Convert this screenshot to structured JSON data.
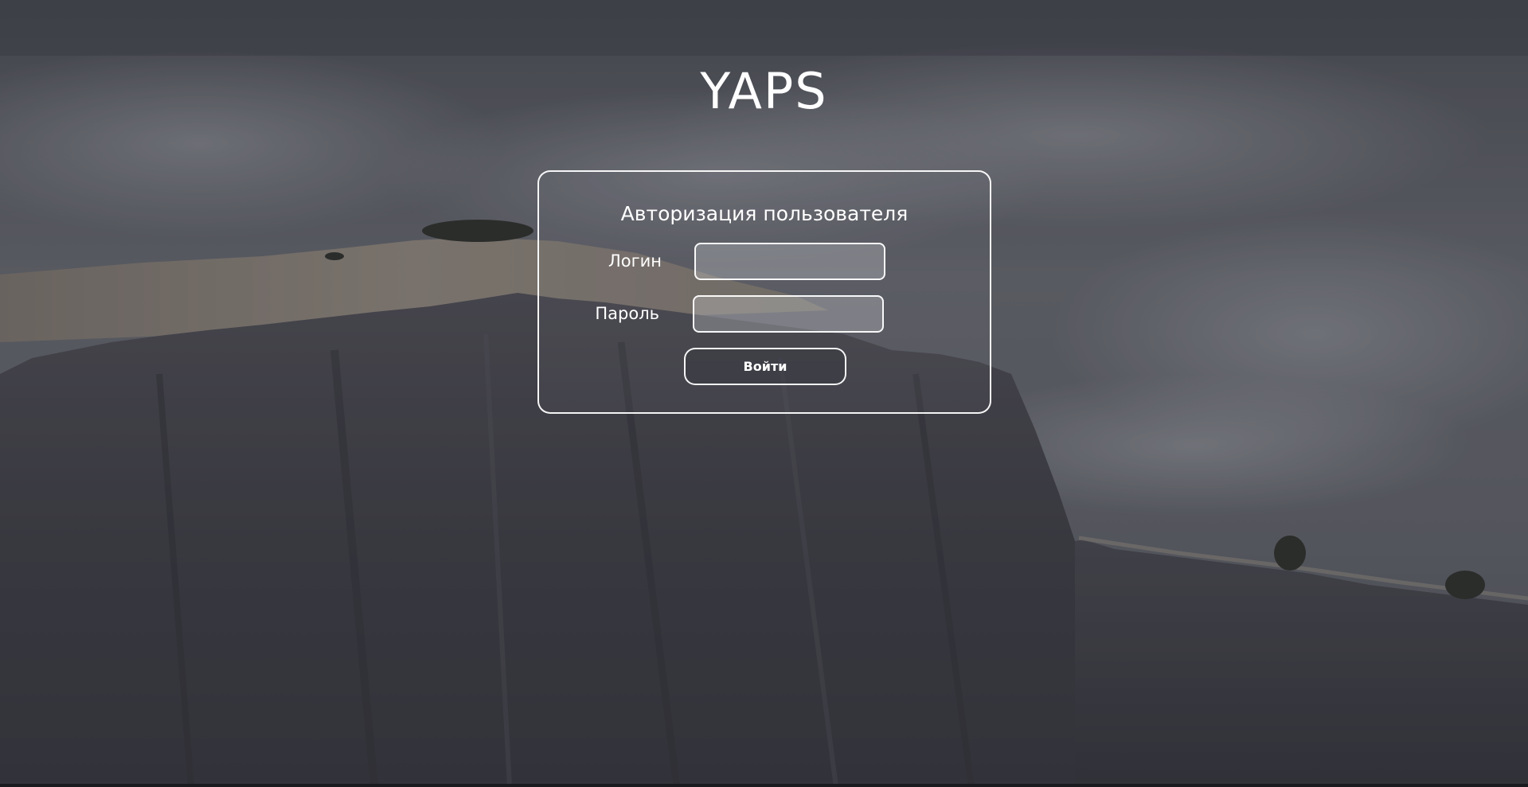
{
  "app": {
    "title": "YAPS"
  },
  "login_form": {
    "heading": "Авторизация пользователя",
    "login_label": "Логин",
    "login_value": "",
    "password_label": "Пароль",
    "password_value": "",
    "submit_label": "Войти"
  },
  "theme": {
    "text_color": "#ffffff",
    "panel_border": "#ffffff",
    "sky_color": "#55575f",
    "rock_color": "#3a3a42"
  }
}
